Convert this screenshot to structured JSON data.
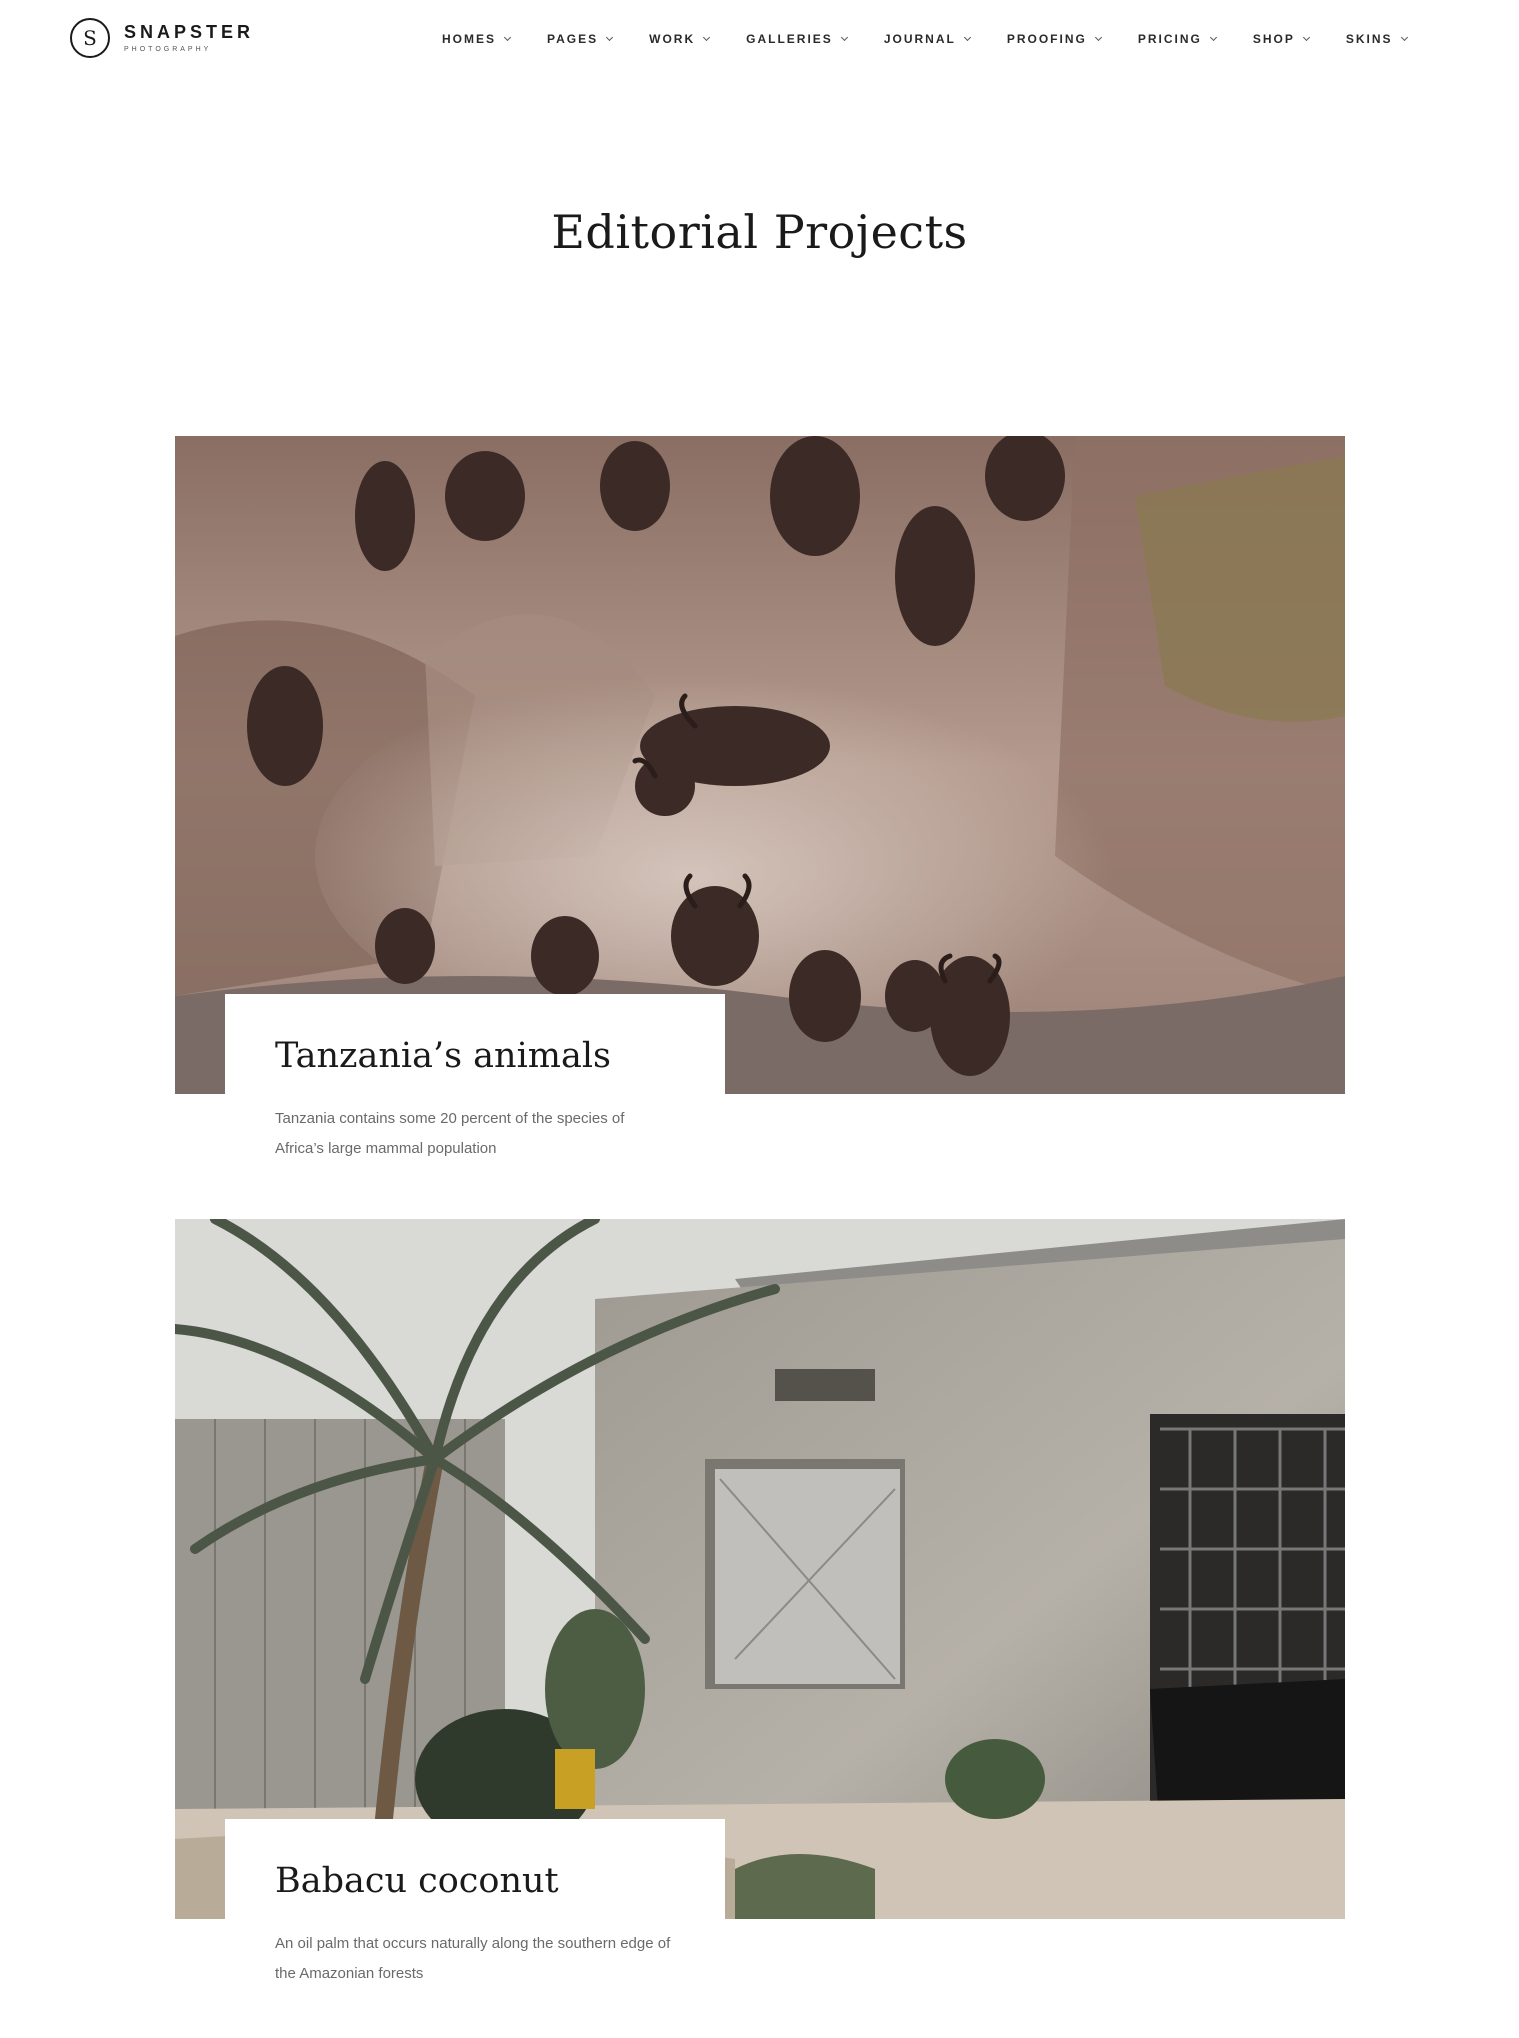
{
  "brand": {
    "logo_letter": "S",
    "name": "SNAPSTER",
    "tagline": "PHOTOGRAPHY"
  },
  "nav": {
    "items": [
      {
        "label": "HOMES"
      },
      {
        "label": "PAGES"
      },
      {
        "label": "WORK"
      },
      {
        "label": "GALLERIES"
      },
      {
        "label": "JOURNAL"
      },
      {
        "label": "PROOFING"
      },
      {
        "label": "PRICING"
      },
      {
        "label": "SHOP"
      },
      {
        "label": "SKINS"
      }
    ]
  },
  "page": {
    "title": "Editorial Projects"
  },
  "projects": [
    {
      "title": "Tanzania’s animals",
      "description": "Tanzania contains some 20 percent of the species of Africa’s large mammal population"
    },
    {
      "title": "Babacu coconut",
      "description": "An oil palm that occurs naturally along the southern edge of the Amazonian forests"
    }
  ],
  "colors": {
    "text": "#1a1a1a",
    "muted_text": "#6a6a6a",
    "background": "#ffffff"
  }
}
